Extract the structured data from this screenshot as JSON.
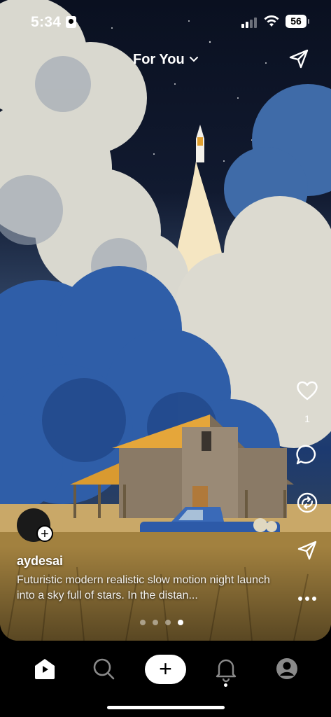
{
  "status_bar": {
    "time": "5:34",
    "battery": "56"
  },
  "header": {
    "feed_label": "For You"
  },
  "post": {
    "username": "aydesai",
    "caption": "Futuristic modern realistic slow motion night launch into a sky full of stars. In the distan...",
    "like_count": "1",
    "image_count": 4,
    "active_image": 4
  },
  "icons": {
    "top_share": "paper-plane-icon",
    "like": "heart-icon",
    "comment": "speech-bubble-icon",
    "repost": "repost-icon",
    "share": "paper-plane-icon",
    "more": "ellipsis-icon",
    "tabs": [
      "home-icon",
      "search-icon",
      "plus-icon",
      "bell-icon",
      "profile-icon"
    ]
  }
}
